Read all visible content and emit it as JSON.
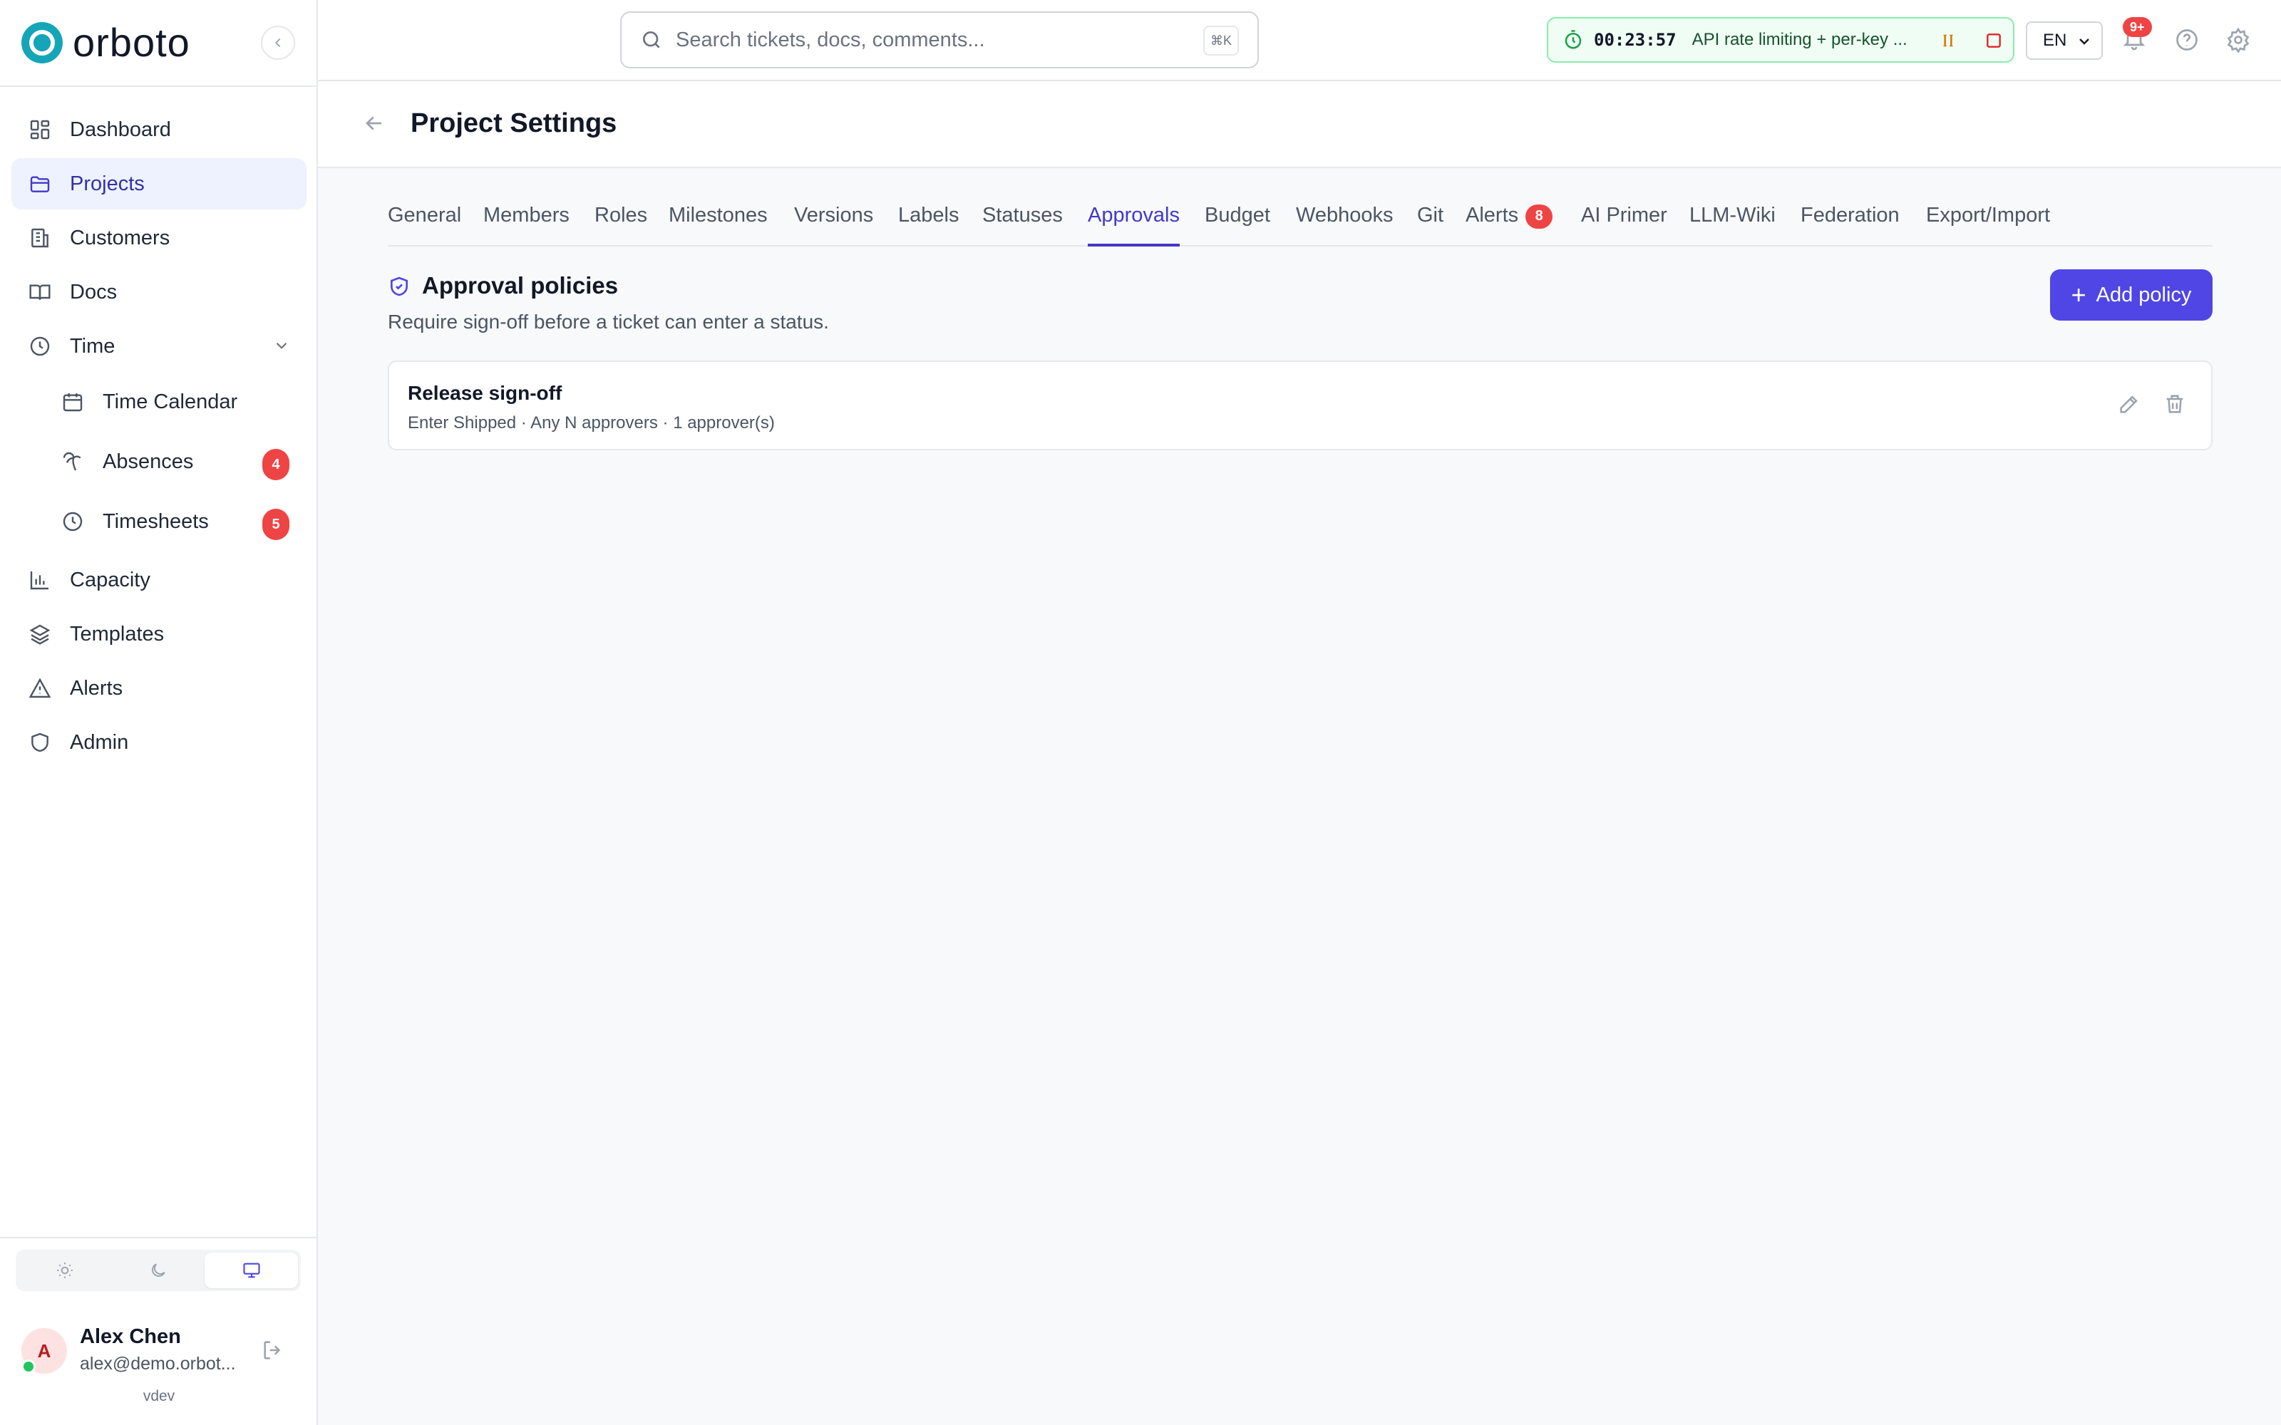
{
  "app": {
    "name": "orboto",
    "version": "vdev"
  },
  "sidebar": {
    "items": [
      {
        "label": "Dashboard",
        "icon": "dashboard-icon"
      },
      {
        "label": "Projects",
        "icon": "folder-icon",
        "active": true
      },
      {
        "label": "Customers",
        "icon": "building-icon"
      },
      {
        "label": "Docs",
        "icon": "book-icon"
      },
      {
        "label": "Time",
        "icon": "clock-icon",
        "expanded": true
      },
      {
        "label": "Time Calendar",
        "icon": "calendar-icon"
      },
      {
        "label": "Absences",
        "icon": "palm-icon",
        "badge": "4"
      },
      {
        "label": "Timesheets",
        "icon": "clock-icon",
        "badge": "5"
      },
      {
        "label": "Capacity",
        "icon": "bar-chart-icon"
      },
      {
        "label": "Templates",
        "icon": "layers-icon"
      },
      {
        "label": "Alerts",
        "icon": "warning-icon"
      },
      {
        "label": "Admin",
        "icon": "shield-icon"
      }
    ],
    "theme": {
      "options": [
        "light",
        "dark",
        "system"
      ],
      "selected": "system"
    },
    "user": {
      "initial": "A",
      "name": "Alex Chen",
      "email": "alex@demo.orbot..."
    }
  },
  "topbar": {
    "search_placeholder": "Search tickets, docs, comments...",
    "search_shortcut": "⌘K",
    "timer": {
      "elapsed": "00:23:57",
      "task": "API rate limiting + per-key ..."
    },
    "language": "EN",
    "notifications_badge": "9+"
  },
  "header": {
    "title": "Project Settings"
  },
  "tabs": [
    {
      "label": "General"
    },
    {
      "label": "Members"
    },
    {
      "label": "Roles"
    },
    {
      "label": "Milestones"
    },
    {
      "label": "Versions"
    },
    {
      "label": "Labels"
    },
    {
      "label": "Statuses"
    },
    {
      "label": "Approvals",
      "active": true
    },
    {
      "label": "Budget"
    },
    {
      "label": "Webhooks"
    },
    {
      "label": "Git"
    },
    {
      "label": "Alerts",
      "badge": "8"
    },
    {
      "label": "AI Primer"
    },
    {
      "label": "LLM-Wiki"
    },
    {
      "label": "Federation"
    },
    {
      "label": "Export/Import"
    }
  ],
  "approvals": {
    "title": "Approval policies",
    "description": "Require sign-off before a ticket can enter a status.",
    "add_label": "Add policy",
    "policies": [
      {
        "name": "Release sign-off",
        "meta": "Enter Shipped · Any N approvers · 1 approver(s)"
      }
    ]
  },
  "colors": {
    "accent": "#4f46e5",
    "brand": "#14a6b8",
    "badge": "#ef4444",
    "timer_bg": "#f0fdf4"
  }
}
